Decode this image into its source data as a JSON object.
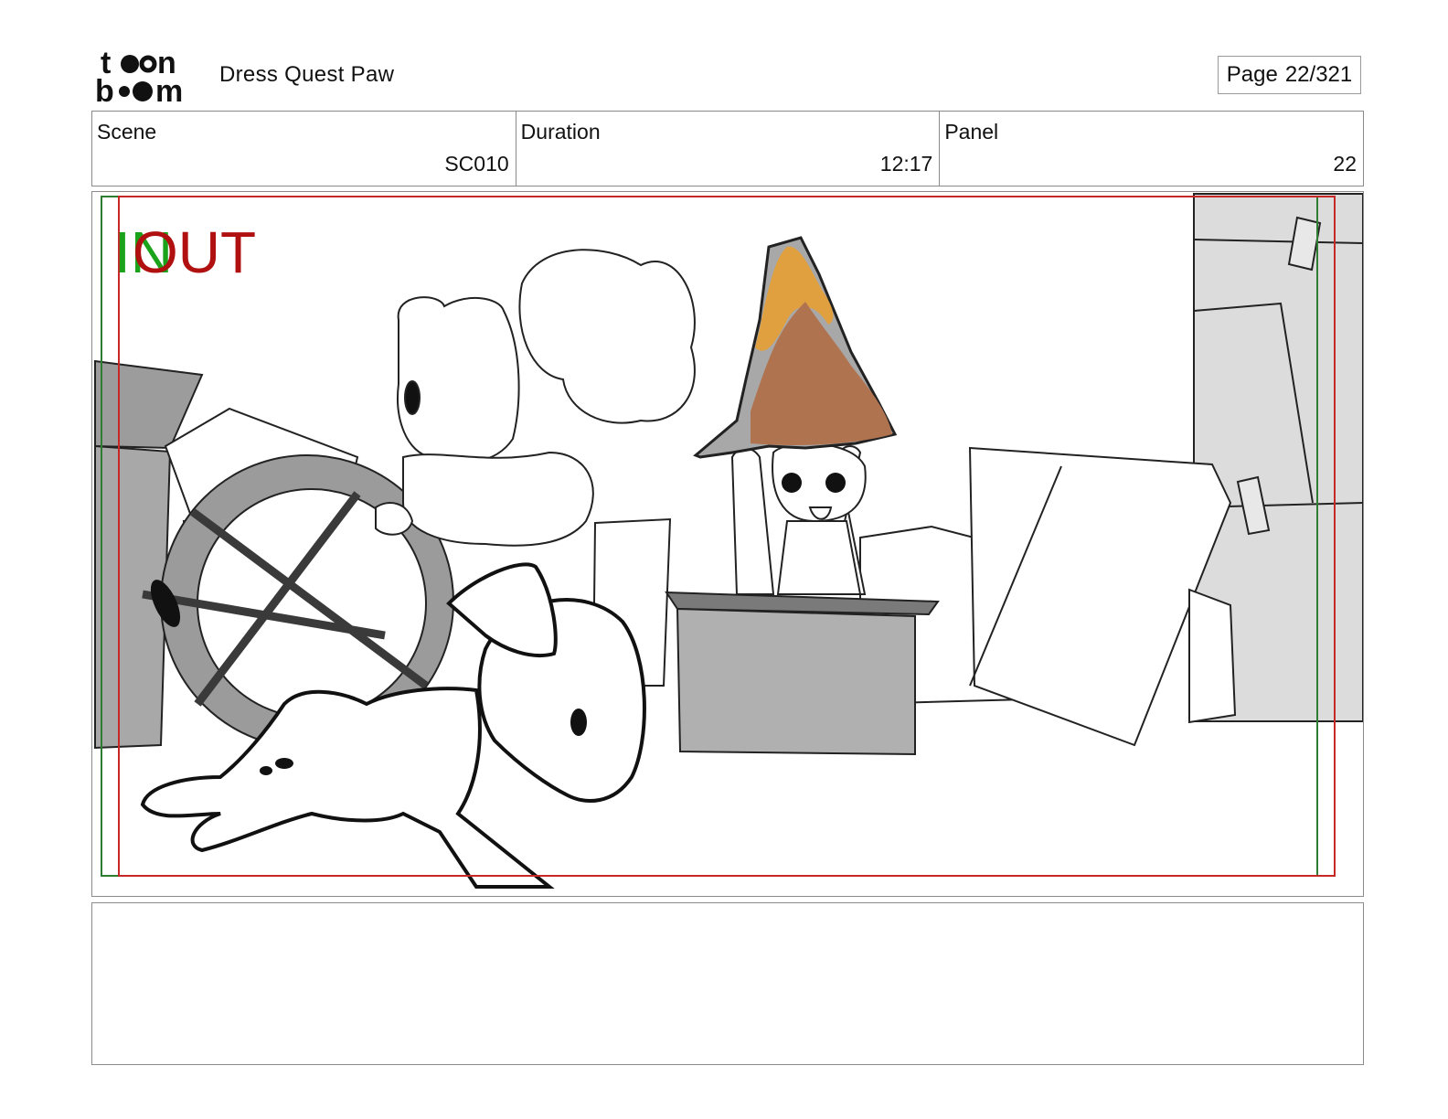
{
  "header": {
    "logo_text": "toonboom",
    "project_title": "Dress Quest Paw",
    "page": {
      "label": "Page",
      "value": "22/321"
    }
  },
  "info": {
    "scene": {
      "label": "Scene",
      "value": "SC010"
    },
    "duration": {
      "label": "Duration",
      "value": "12:17"
    },
    "panel": {
      "label": "Panel",
      "value": "22"
    }
  },
  "panel_image": {
    "markers": {
      "in": "IN",
      "out": "OUT"
    },
    "colors": {
      "in_marker": "#1aa21a",
      "out_marker": "#b01010",
      "safe_frame_red": "#c62828",
      "safe_frame_green": "#2e7d32",
      "hat_orange": "#e0a040",
      "hat_brown": "#b07350"
    }
  },
  "notes": {
    "text": ""
  }
}
